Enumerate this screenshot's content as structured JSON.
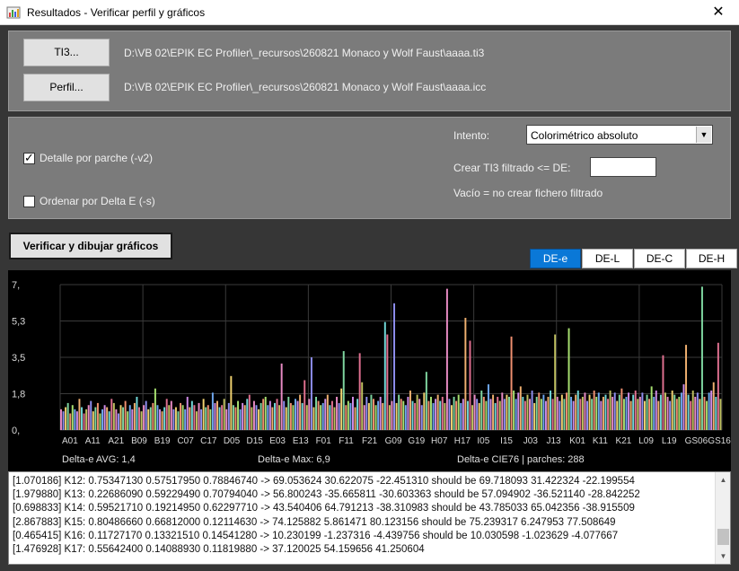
{
  "window": {
    "title": "Resultados - Verificar perfil y gráficos",
    "close_glyph": "✕"
  },
  "files": {
    "ti3_button": "TI3...",
    "ti3_path": "D:\\VB 02\\EPIK EC Profiler\\_recursos\\260821 Monaco y Wolf Faust\\aaaa.ti3",
    "perfil_button": "Perfil...",
    "icc_path": "D:\\VB 02\\EPIK EC Profiler\\_recursos\\260821 Monaco y Wolf Faust\\aaaa.icc"
  },
  "options": {
    "detalle_label": "Detalle por parche (-v2)",
    "detalle_checked": true,
    "ordenar_label": "Ordenar por Delta E (-s)",
    "ordenar_checked": false,
    "intento_label": "Intento:",
    "intento_value": "Colorimétrico absoluto",
    "crear_label": "Crear TI3 filtrado <= DE:",
    "crear_value": "",
    "vacio_label": "Vacío = no crear fichero filtrado"
  },
  "verify_button": "Verificar y dibujar gráficos",
  "tabs": [
    {
      "label": "DE-e",
      "active": true
    },
    {
      "label": "DE-L",
      "active": false
    },
    {
      "label": "DE-C",
      "active": false
    },
    {
      "label": "DE-H",
      "active": false
    }
  ],
  "chart_data": {
    "type": "bar",
    "ylim": [
      0,
      7
    ],
    "y_ticks": [
      "7,",
      "5,3",
      "3,5",
      "1,8",
      "0,"
    ],
    "x_tick_labels": [
      "A01",
      "A11",
      "A21",
      "B09",
      "B19",
      "C07",
      "C17",
      "D05",
      "D15",
      "E03",
      "E13",
      "F01",
      "F11",
      "F21",
      "G09",
      "G19",
      "H07",
      "H17",
      "I05",
      "I15",
      "J03",
      "J13",
      "K01",
      "K11",
      "K21",
      "L09",
      "L19",
      "GS06",
      "GS16"
    ],
    "grid": true,
    "patches": 288,
    "footer": {
      "avg": "Delta-e AVG:  1,4",
      "max": "Delta-e Max:  6,9",
      "info": "Delta-e CIE76 | parches: 288"
    },
    "values": [
      1.0,
      0.9,
      1.1,
      1.3,
      0.8,
      1.2,
      1.0,
      0.9,
      1.5,
      1.1,
      0.8,
      1.0,
      1.2,
      1.4,
      0.9,
      1.1,
      1.3,
      0.8,
      1.0,
      1.2,
      1.1,
      0.9,
      1.5,
      1.3,
      1.0,
      0.8,
      1.2,
      1.1,
      1.4,
      0.9,
      1.2,
      1.0,
      1.3,
      1.6,
      1.1,
      0.9,
      1.2,
      1.4,
      1.0,
      1.1,
      1.3,
      2.0,
      1.2,
      1.0,
      0.9,
      1.1,
      1.5,
      1.2,
      1.4,
      1.0,
      1.1,
      0.9,
      1.3,
      1.2,
      1.0,
      1.6,
      1.1,
      1.4,
      1.2,
      0.9,
      1.3,
      1.0,
      1.5,
      1.1,
      1.2,
      1.0,
      1.8,
      1.3,
      1.4,
      1.1,
      1.2,
      1.5,
      1.0,
      1.3,
      2.6,
      1.2,
      1.1,
      1.4,
      1.0,
      1.3,
      1.2,
      1.5,
      1.7,
      1.1,
      1.4,
      1.2,
      1.0,
      1.3,
      1.5,
      1.6,
      1.2,
      1.4,
      1.1,
      1.3,
      1.5,
      1.2,
      3.2,
      1.4,
      1.1,
      1.6,
      1.3,
      1.2,
      1.5,
      1.4,
      1.7,
      1.3,
      2.4,
      1.2,
      1.5,
      1.3,
      1.1,
      1.6,
      1.4,
      1.2,
      1.3,
      1.5,
      1.7,
      1.2,
      1.4,
      1.1,
      1.6,
      1.3,
      2.0,
      1.5,
      1.2,
      1.4,
      1.3,
      1.6,
      1.1,
      1.5,
      1.4,
      2.3,
      1.2,
      1.6,
      1.3,
      1.7,
      1.5,
      1.2,
      1.4,
      1.6,
      1.3,
      1.8,
      1.5,
      1.2,
      1.4,
      1.6,
      1.3,
      1.7,
      1.5,
      1.4,
      1.2,
      1.6,
      1.9,
      1.4,
      1.3,
      1.7,
      1.5,
      1.2,
      1.8,
      2.8,
      1.4,
      1.6,
      1.3,
      1.5,
      1.7,
      1.4,
      1.6,
      1.3,
      1.8,
      1.5,
      1.2,
      1.6,
      1.4,
      1.7,
      1.3,
      1.5,
      1.8,
      1.4,
      1.6,
      1.2,
      1.7,
      1.5,
      1.3,
      1.9,
      1.6,
      1.4,
      2.2,
      1.5,
      1.7,
      1.3,
      1.6,
      1.4,
      1.8,
      1.5,
      1.7,
      1.6,
      1.4,
      1.9,
      1.5,
      1.8,
      2.1,
      1.6,
      1.4,
      1.7,
      1.5,
      1.9,
      1.3,
      1.6,
      1.8,
      1.5,
      1.7,
      1.4,
      1.6,
      1.9,
      1.5,
      1.8,
      1.6,
      1.4,
      1.7,
      1.5,
      1.8,
      2.0,
      1.6,
      1.4,
      1.7,
      1.9,
      1.5,
      1.6,
      1.8,
      1.4,
      1.7,
      1.5,
      1.9,
      1.6,
      1.8,
      1.4,
      1.6,
      1.7,
      1.5,
      1.9,
      1.6,
      1.8,
      1.4,
      1.7,
      2.0,
      1.5,
      1.6,
      1.8,
      1.4,
      1.7,
      1.9,
      1.5,
      1.6,
      1.8,
      1.4,
      1.7,
      1.5,
      2.1,
      1.6,
      1.9,
      1.4,
      1.7,
      1.5,
      1.8,
      1.6,
      1.4,
      1.9,
      1.7,
      1.5,
      1.6,
      1.8,
      2.2,
      1.5,
      1.7,
      1.4,
      1.9,
      1.6,
      1.8,
      1.5,
      1.7,
      1.6,
      1.4,
      1.8,
      1.9,
      2.3,
      1.6,
      1.7,
      1.5,
      1.8,
      1.4,
      1.6,
      1.9,
      1.7,
      1.5,
      2.0,
      1.8,
      2.2,
      1.6,
      1.9,
      2.4,
      1.8,
      2.1,
      1.9,
      2.5,
      2.2,
      2.8,
      1.6,
      1.7,
      1.5,
      1.8,
      2.0,
      1.4,
      1.6,
      1.9,
      3.0,
      1.7,
      1.5,
      1.8,
      1.6,
      1.4,
      1.9,
      1.7,
      1.5,
      1.6,
      1.8,
      1.4,
      1.7,
      1.5,
      1.9,
      1.6,
      1.8,
      1.4,
      1.7,
      2.0,
      1.5,
      1.6,
      1.8,
      1.4,
      1.7,
      1.9,
      1.5,
      1.6,
      1.8,
      1.4,
      1.7,
      1.5,
      2.1,
      1.6,
      1.9,
      1.4,
      1.7,
      1.5,
      1.8,
      1.6,
      1.4,
      1.9,
      1.7,
      1.5,
      1.6,
      1.8,
      2.2,
      1.5,
      1.7,
      1.4,
      1.9,
      1.6,
      1.8,
      1.5,
      1.7,
      1.6,
      1.4,
      1.8,
      1.9,
      2.3,
      1.6,
      1.7,
      1.5,
      1.8,
      1.4,
      1.6,
      1.9,
      1.7,
      1.5,
      2.0,
      1.8,
      2.2,
      1.6,
      1.9,
      2.4,
      1.8,
      2.1,
      1.9,
      2.5,
      2.2,
      2.8,
      1.6
    ],
    "spikes": [
      {
        "index": 145,
        "value": 6.1
      },
      {
        "index": 141,
        "value": 5.2
      },
      {
        "index": 142,
        "value": 4.6
      },
      {
        "index": 168,
        "value": 6.8
      },
      {
        "index": 176,
        "value": 5.4
      },
      {
        "index": 178,
        "value": 4.3
      },
      {
        "index": 215,
        "value": 4.6
      },
      {
        "index": 221,
        "value": 4.9
      },
      {
        "index": 196,
        "value": 4.5
      },
      {
        "index": 262,
        "value": 3.6
      },
      {
        "index": 279,
        "value": 6.9
      },
      {
        "index": 272,
        "value": 4.1
      },
      {
        "index": 286,
        "value": 4.2
      },
      {
        "index": 123,
        "value": 3.8
      },
      {
        "index": 130,
        "value": 3.7
      },
      {
        "index": 109,
        "value": 3.5
      },
      {
        "index": 96,
        "value": 3.2
      }
    ],
    "palette": [
      "#e88bc4",
      "#8f8ff0",
      "#f0d270",
      "#7fd6a0",
      "#f09070",
      "#a7e070",
      "#6fa8f0",
      "#d08ce8",
      "#f0b070",
      "#70d8d8",
      "#e07090",
      "#c0c060"
    ]
  },
  "log": {
    "lines": [
      "[1.070186] K12: 0.75347130 0.57517950 0.78846740 -> 69.053624 30.622075 -22.451310 should be 69.718093 31.422324 -22.199554",
      "[1.979880] K13: 0.22686090 0.59229490 0.70794040 -> 56.800243 -35.665811 -30.603363 should be 57.094902 -36.521140 -28.842252",
      "[0.698833] K14: 0.59521710 0.19214950 0.62297710 -> 43.540406 64.791213 -38.310983 should be 43.785033 65.042356 -38.915509",
      "[2.867883] K15: 0.80486660 0.66812000 0.12114630 -> 74.125882 5.861471 80.123156 should be 75.239317 6.247953 77.508649",
      "[0.465415] K16: 0.11727170 0.13321510 0.14541280 -> 10.230199 -1.237316 -4.439756 should be 10.030598 -1.023629 -4.077667",
      "[1.476928] K17: 0.55642400 0.14088930 0.11819880 -> 37.120025 54.159656 41.250604"
    ]
  }
}
